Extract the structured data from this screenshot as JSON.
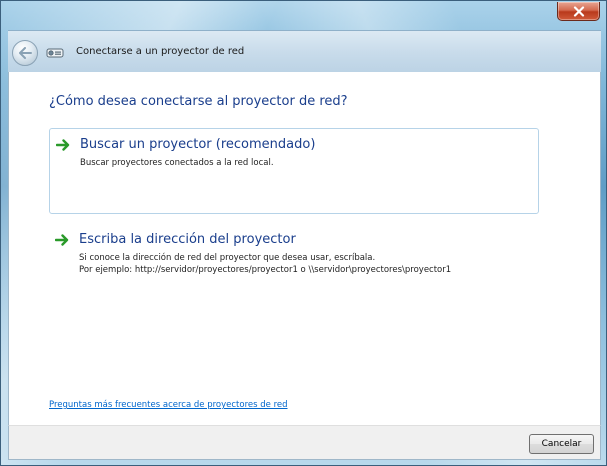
{
  "window": {
    "title": "Conectarse a un proyector de red"
  },
  "colors": {
    "accent_text": "#1a3e8c",
    "link": "#0066cc",
    "arrow_green": "#2a9a2a",
    "close_red": "#c0432a"
  },
  "icons": {
    "back": "back-arrow-icon",
    "app": "projector-icon",
    "close": "close-icon",
    "option_arrow": "green-arrow-icon"
  },
  "main": {
    "question": "¿Cómo desea conectarse al proyector de red?",
    "options": [
      {
        "title": "Buscar un proyector (recomendado)",
        "description": [
          "Buscar proyectores conectados a la red local."
        ]
      },
      {
        "title": "Escriba la dirección del proyector",
        "description": [
          "Si conoce la dirección de red del proyector que desea usar, escríbala.",
          "Por ejemplo: http://servidor/proyectores/proyector1 o \\\\servidor\\proyectores\\proyector1"
        ]
      }
    ],
    "faq_link": "Preguntas más frecuentes acerca de proyectores de red"
  },
  "footer": {
    "cancel_label": "Cancelar"
  }
}
